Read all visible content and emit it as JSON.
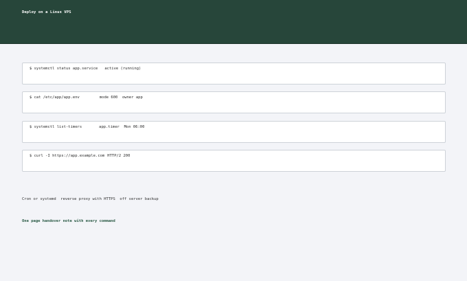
{
  "header": {
    "title": "Deploy on a Linux VPS"
  },
  "commands": [
    {
      "command": "$ systemctl status app.service",
      "output": "active (running)"
    },
    {
      "command": "$ cat /etc/app/app.env",
      "output": "mode 600  owner app"
    },
    {
      "command": "$ systemctl list-timers",
      "output": "app.timer  Mon 06:00"
    },
    {
      "command": "$ curl -I https://app.example.com",
      "output": "HTTP/2 200"
    }
  ],
  "features": {
    "text": "Cron or systemd  reverse proxy with HTTPS  off server backup"
  },
  "note": {
    "text": "One page handover note with every command"
  },
  "colors": {
    "header_bg": "#27463a",
    "page_bg": "#f3f4f8",
    "note_accent": "#2a5a45"
  }
}
